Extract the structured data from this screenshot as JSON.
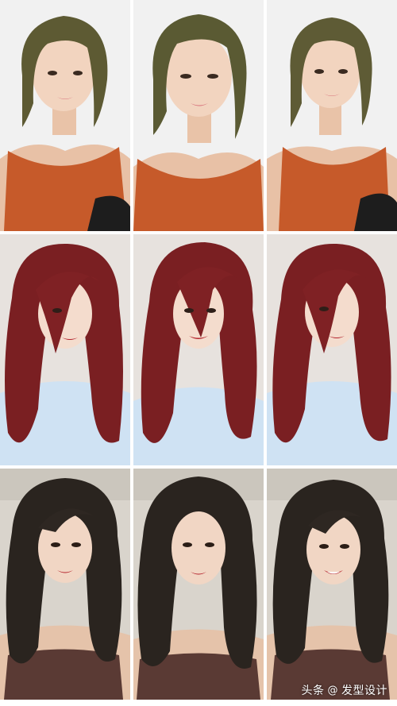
{
  "photos": [
    {
      "row": 1,
      "hair_color": "olive-green short bob",
      "top_color": "#c65a2a",
      "bg": "#f1f1f1"
    },
    {
      "row": 1,
      "hair_color": "olive-green short bob",
      "top_color": "#c65a2a",
      "bg": "#f1f1f1"
    },
    {
      "row": 1,
      "hair_color": "olive-green short bob",
      "top_color": "#c65a2a",
      "bg": "#f1f1f1"
    },
    {
      "row": 2,
      "hair_color": "wine-red long layered",
      "top_color": "#cfe2f3",
      "bg": "#e7e2de"
    },
    {
      "row": 2,
      "hair_color": "wine-red long layered",
      "top_color": "#cfe2f3",
      "bg": "#e7e2de"
    },
    {
      "row": 2,
      "hair_color": "wine-red long layered",
      "top_color": "#cfe2f3",
      "bg": "#e7e2de"
    },
    {
      "row": 3,
      "hair_color": "dark brown long waves",
      "top_color": "#5a3a34",
      "bg": "#d9d4cc"
    },
    {
      "row": 3,
      "hair_color": "dark brown long waves",
      "top_color": "#5a3a34",
      "bg": "#d9d4cc"
    },
    {
      "row": 3,
      "hair_color": "dark brown long waves",
      "top_color": "#5a3a34",
      "bg": "#d9d4cc"
    }
  ],
  "watermark": {
    "platform": "头条",
    "at": "@",
    "account": "发型设计"
  }
}
